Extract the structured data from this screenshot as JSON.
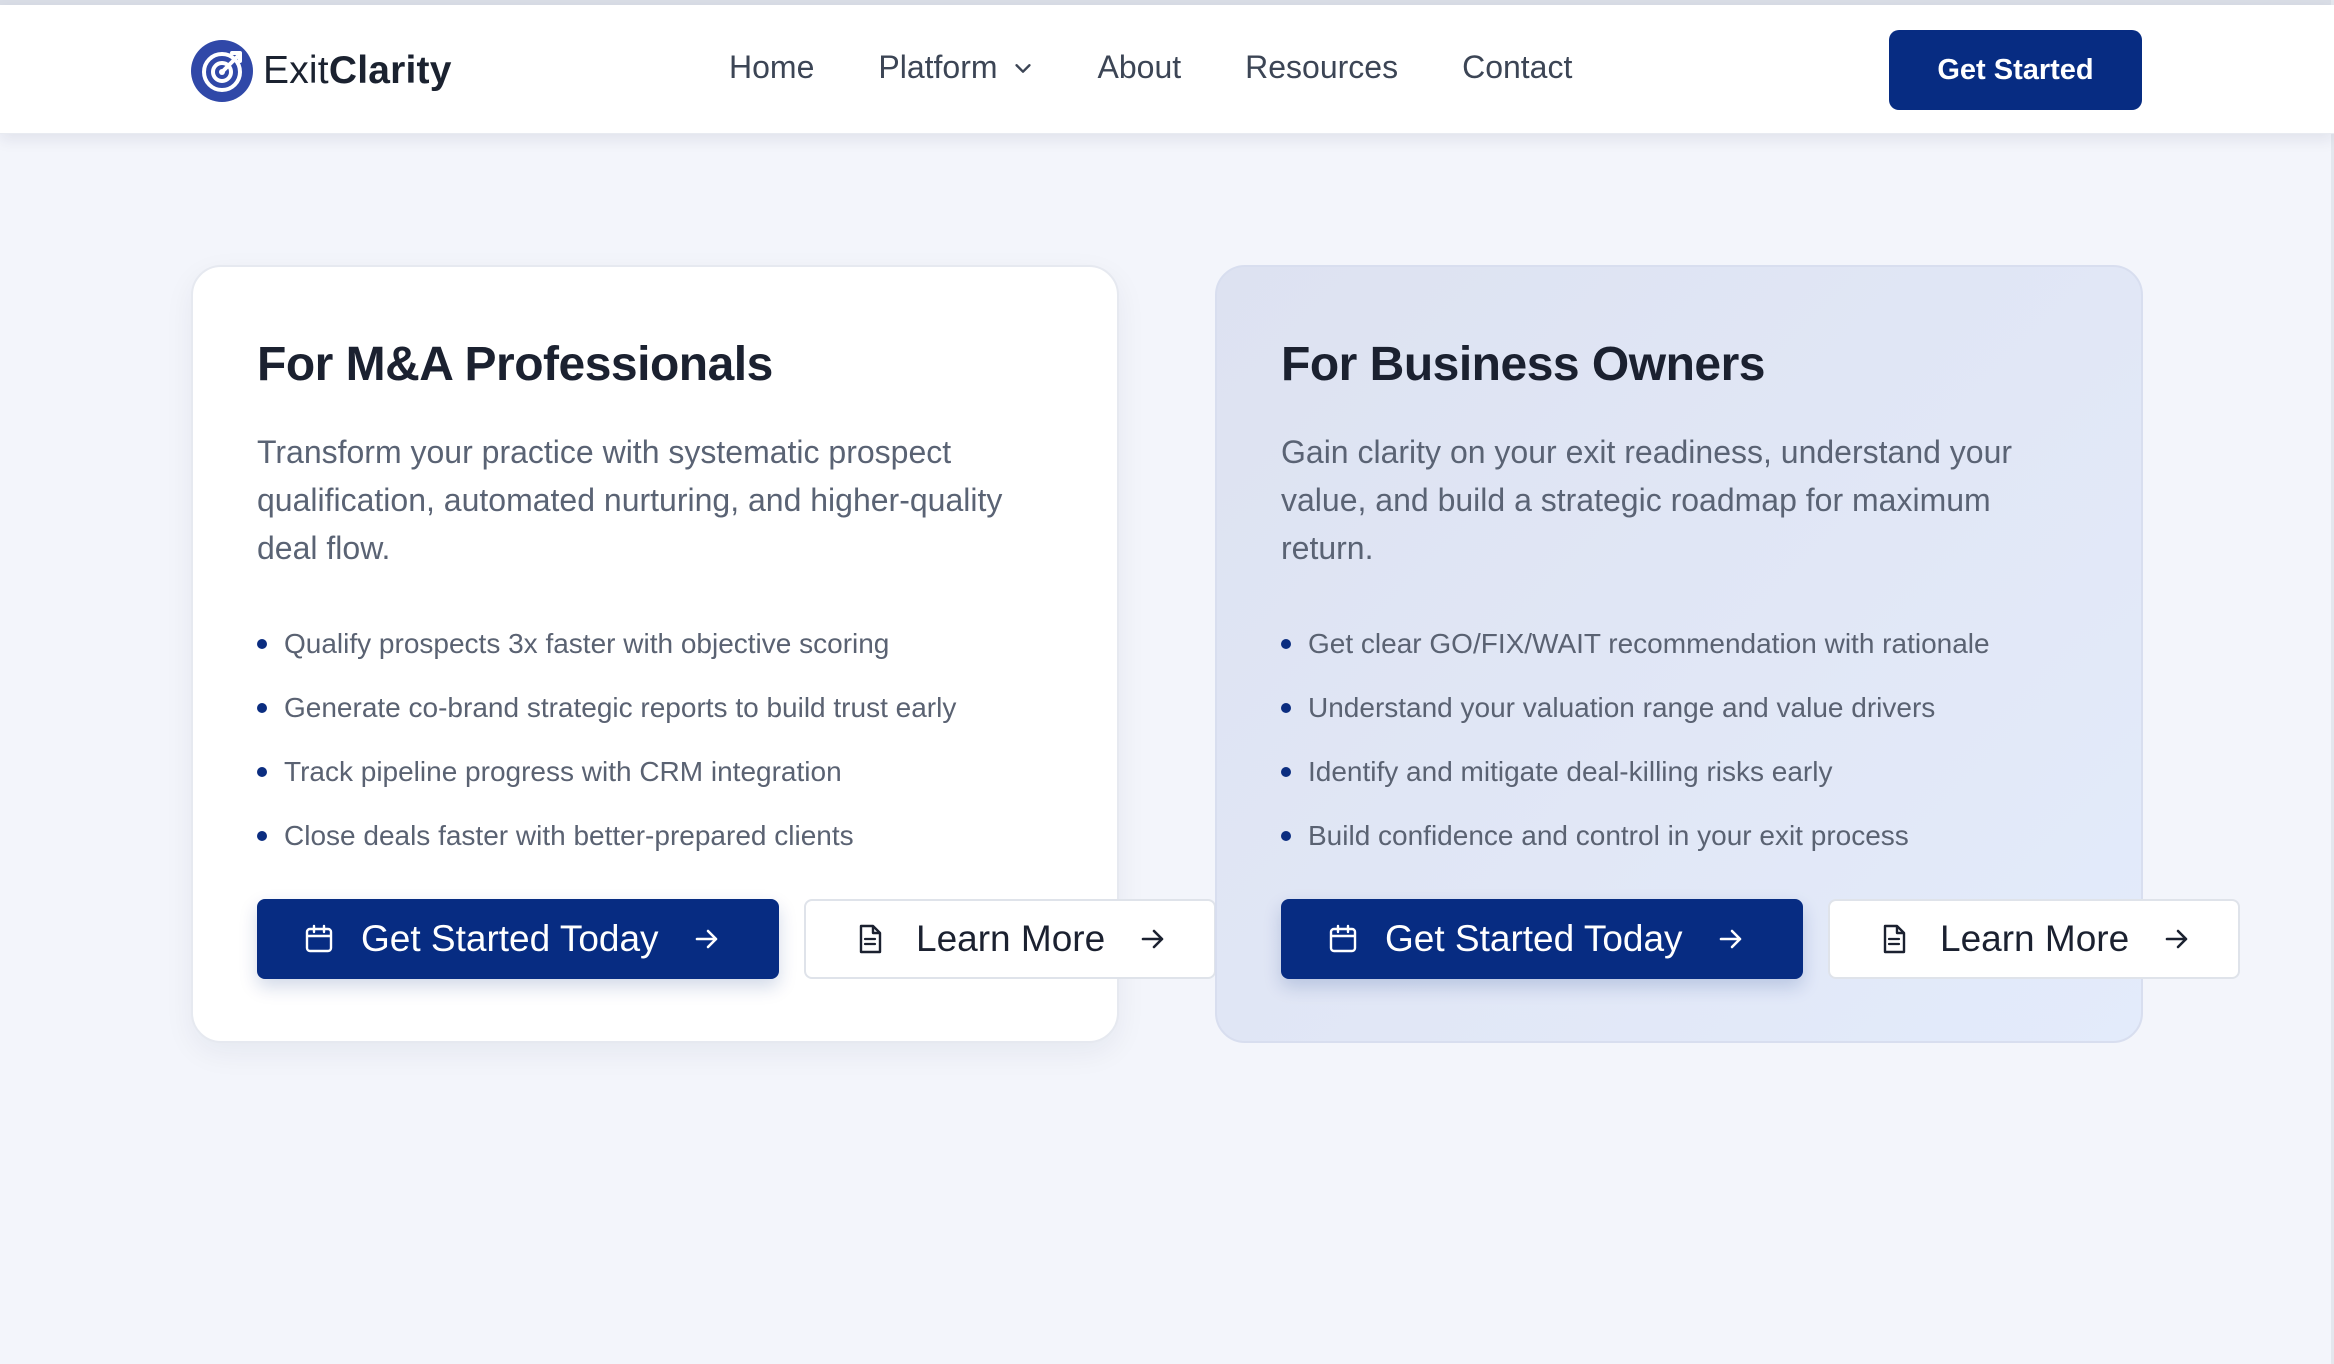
{
  "brand": {
    "name_light": "Exit",
    "name_bold": "Clarity"
  },
  "nav": {
    "items": [
      {
        "label": "Home"
      },
      {
        "label": "Platform"
      },
      {
        "label": "About"
      },
      {
        "label": "Resources"
      },
      {
        "label": "Contact"
      }
    ],
    "cta_label": "Get Started"
  },
  "cards": [
    {
      "title": "For M&A Professionals",
      "description": "Transform your practice with systematic prospect qualification, automated nurturing, and higher-quality deal flow.",
      "bullets": [
        "Qualify prospects 3x faster with objective scoring",
        "Generate co-brand strategic reports to build trust early",
        "Track pipeline progress with CRM integration",
        "Close deals faster with better-prepared clients"
      ],
      "primary_label": "Get Started Today",
      "secondary_label": "Learn More"
    },
    {
      "title": "For Business Owners",
      "description": "Gain clarity on your exit readiness, understand your value, and build a strategic roadmap for maximum return.",
      "bullets": [
        "Get clear GO/FIX/WAIT recommendation with rationale",
        "Understand your valuation range and value drivers",
        "Identify and mitigate deal-killing risks early",
        "Build confidence and control in your exit process"
      ],
      "primary_label": "Get Started Today",
      "secondary_label": "Learn More"
    }
  ],
  "icons": {
    "logo": "target-icon",
    "dropdown": "chevron-down-icon",
    "primary": "calendar-icon",
    "secondary": "document-icon",
    "arrow": "arrow-right-icon"
  },
  "colors": {
    "brand_navy": "#072c82",
    "logo_blue": "#3048a8",
    "page_bg": "#f3f5fb",
    "card_alt_bg": "#dfe5f4"
  }
}
